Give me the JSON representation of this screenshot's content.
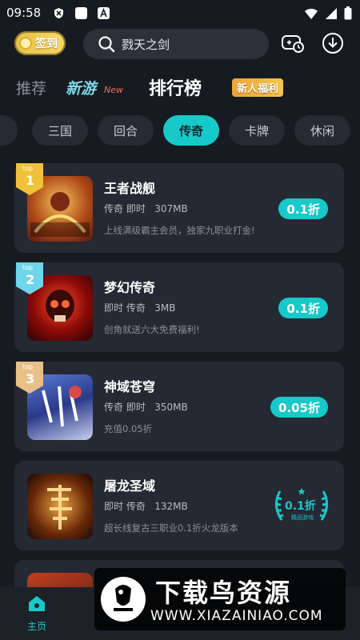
{
  "status": {
    "time": "09:58"
  },
  "topbar": {
    "sign_label": "签到",
    "search_text": "戮天之剑"
  },
  "tabs": {
    "recommend": "推荐",
    "new_games": "新游",
    "new_badge": "New",
    "ranking": "排行榜",
    "welfare": "新人福利"
  },
  "categories": [
    "三国",
    "回合",
    "传奇",
    "卡牌",
    "休闲"
  ],
  "active_category": "传奇",
  "games": [
    {
      "rank": "1",
      "name": "王者战舰",
      "tags": "传奇 即时",
      "size": "307MB",
      "desc": "上线满级霸主会员，独家九职业打金!",
      "discount": "0.1折"
    },
    {
      "rank": "2",
      "name": "梦幻传奇",
      "tags": "即时 传奇",
      "size": "3MB",
      "desc": "创角就送六大免费福利!",
      "discount": "0.1折"
    },
    {
      "rank": "3",
      "name": "神域苍穹",
      "tags": "传奇 即时",
      "size": "350MB",
      "desc": "充值0.05折",
      "discount": "0.05折"
    },
    {
      "rank": "",
      "name": "屠龙圣域",
      "tags": "即时 传奇",
      "size": "132MB",
      "desc": "超长线复古三职业0.1折火龙版本",
      "discount": "0.1折",
      "laurel_sub": "精品游戏"
    }
  ],
  "rank_badge_label": "top",
  "bottom": {
    "home_label": "主页"
  },
  "watermark": {
    "title": "下载鸟资源",
    "url": "WWW.XIAZAINIAO.COM"
  },
  "colors": {
    "accent": "#17c9c9",
    "background": "#161a21",
    "card": "#242933",
    "gold": "#f0c23a"
  }
}
